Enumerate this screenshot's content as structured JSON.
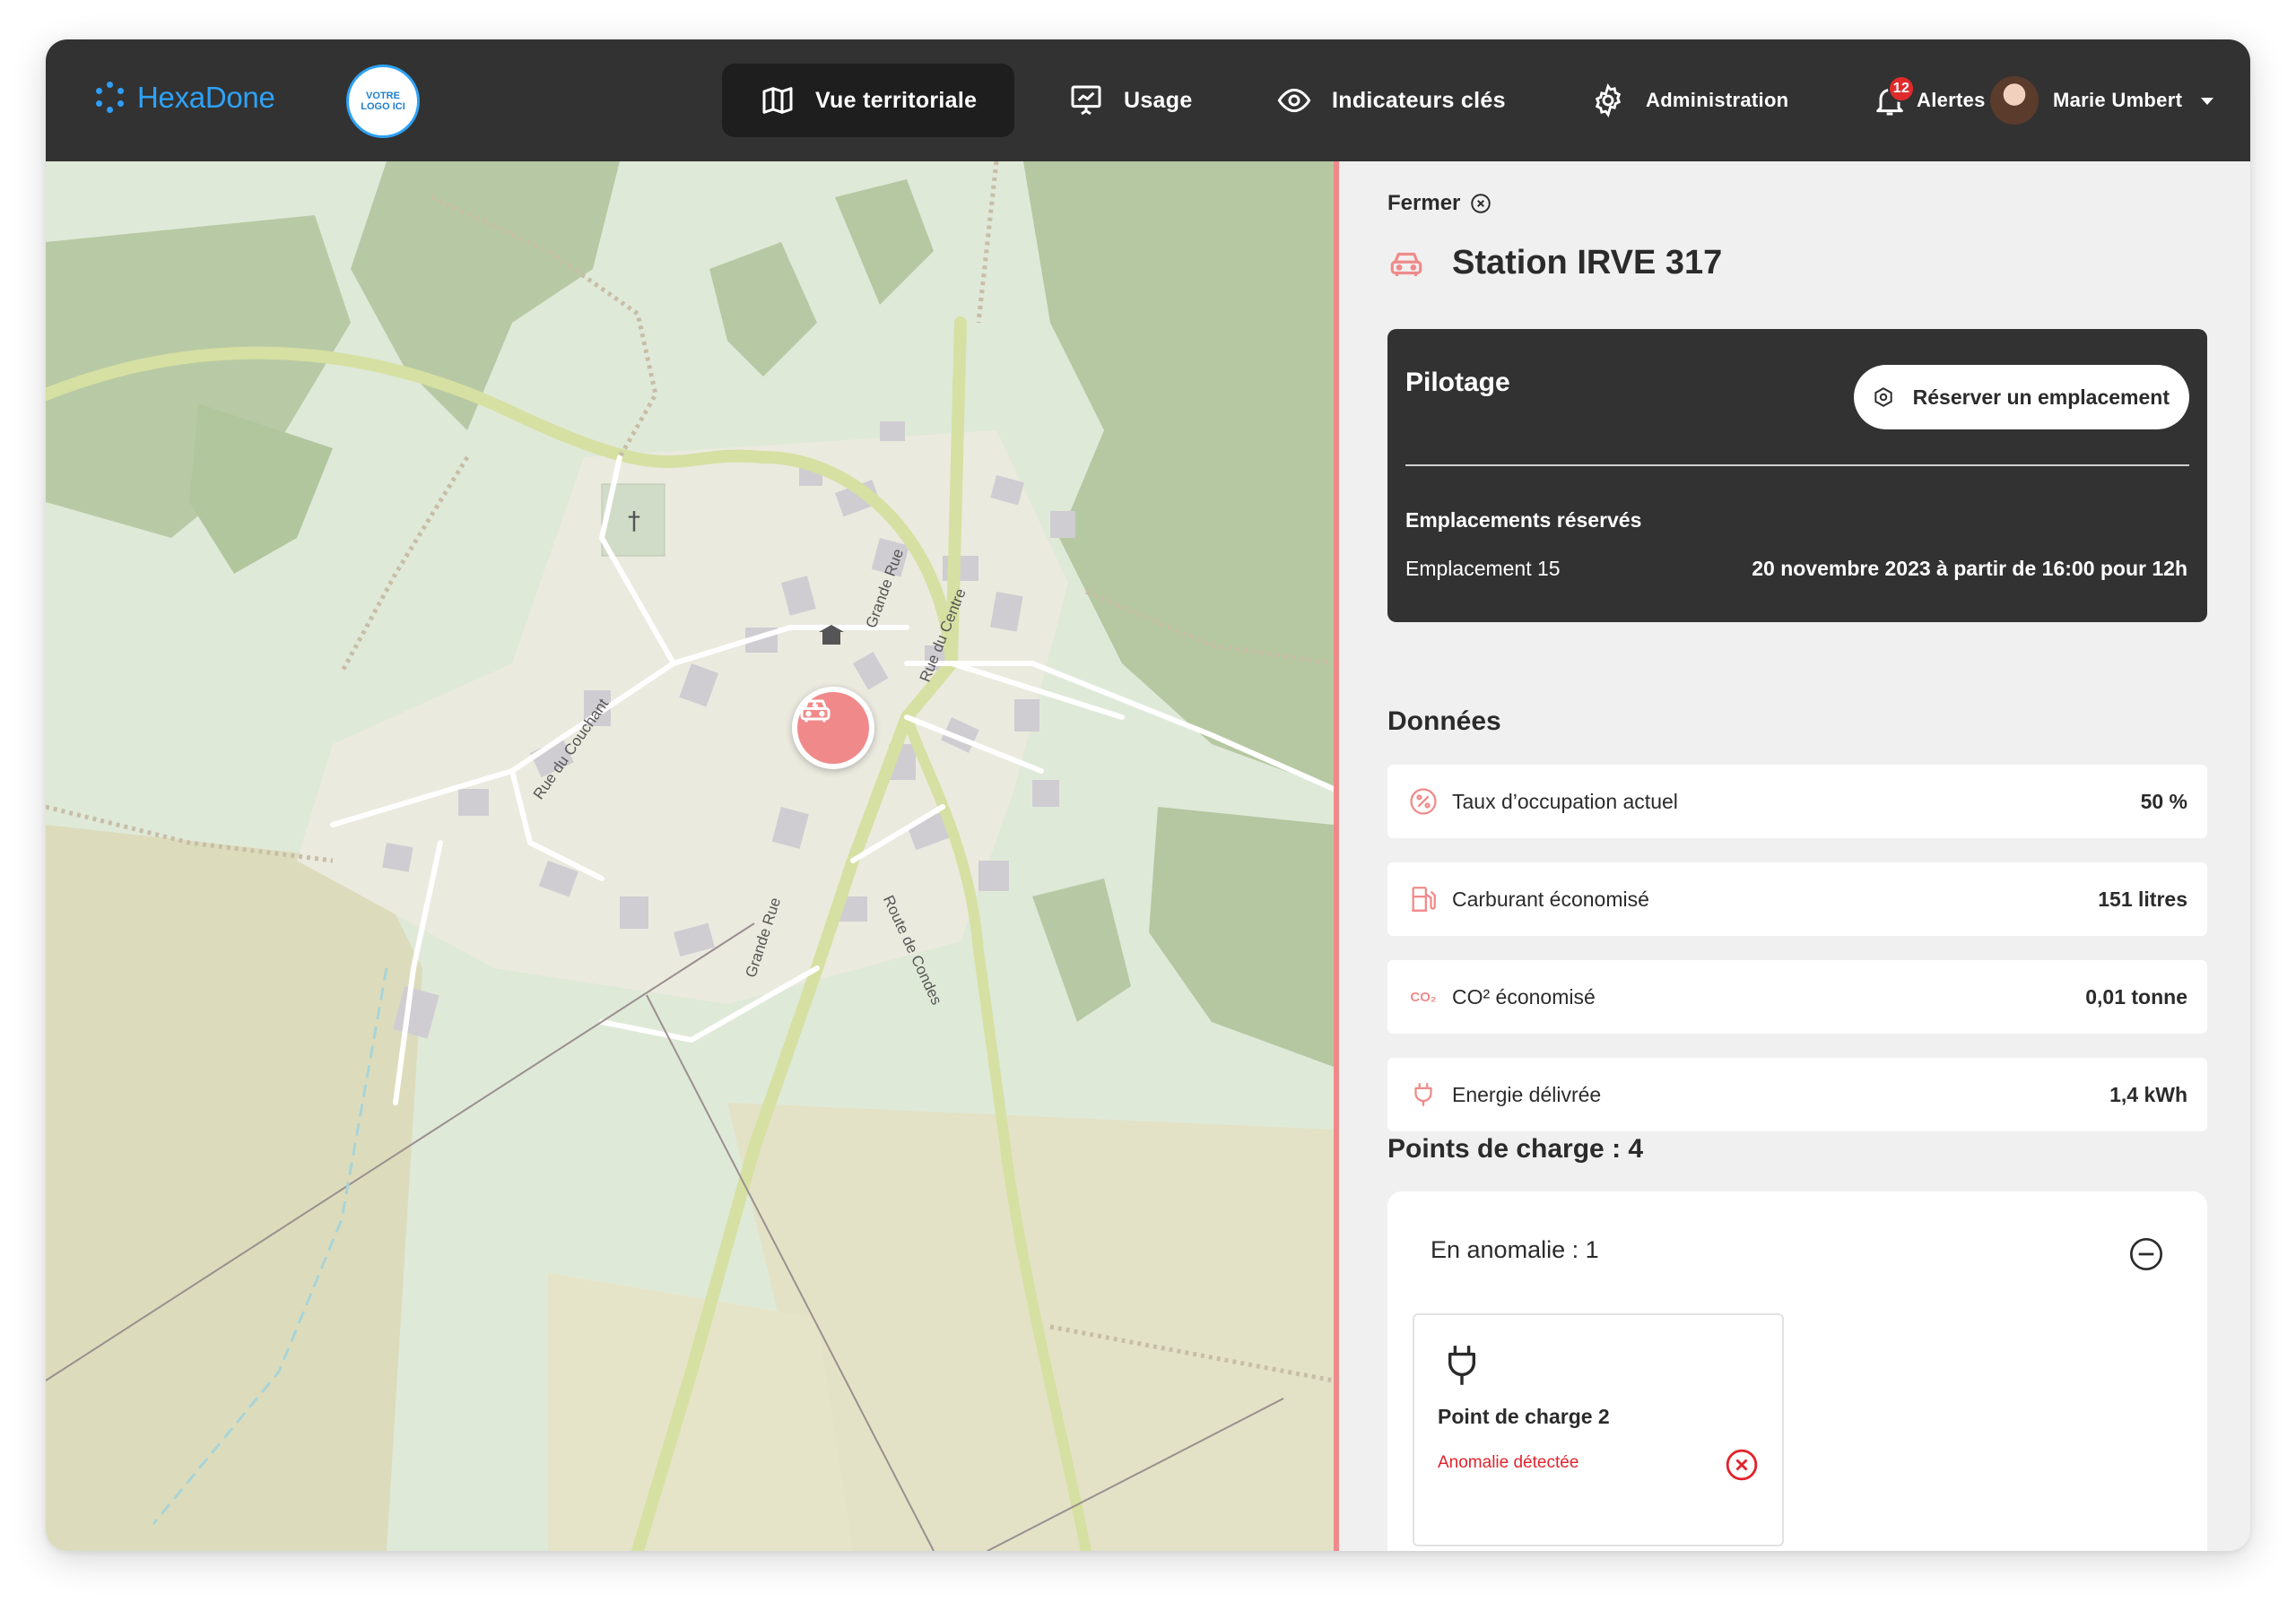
{
  "brand": {
    "name": "HexaDone",
    "client_logo": "VOTRE\nLOGO ICI"
  },
  "nav": {
    "items": [
      {
        "label": "Vue territoriale",
        "icon": "map-icon",
        "active": true
      },
      {
        "label": "Usage",
        "icon": "presentation-chart-icon"
      },
      {
        "label": "Indicateurs clés",
        "icon": "eye-icon"
      },
      {
        "label": "Administration",
        "icon": "gear-icon"
      },
      {
        "label": "Alertes",
        "icon": "bell-icon",
        "badge": "12"
      }
    ],
    "user": {
      "name": "Marie Umbert",
      "icon": "chevron-down-icon"
    }
  },
  "map": {
    "street_labels": [
      "Grande Rue",
      "Rue du Centre",
      "Rue du Couchant",
      "Grande Rue",
      "Route de Condes"
    ],
    "marker_icon": "charging-station-icon"
  },
  "panel": {
    "close_label": "Fermer",
    "station_title": "Station IRVE 317",
    "station_icon": "charging-station-icon",
    "pilotage": {
      "title": "Pilotage",
      "reserve_button": "Réserver un emplacement",
      "reserved_title": "Emplacements réservés",
      "reservation": {
        "slot": "Emplacement 15",
        "date": "20 novembre 2023 à partir de 16:00 pour 12h"
      }
    },
    "data_title": "Données",
    "data": [
      {
        "label": "Taux d’occupation actuel",
        "value": "50 %",
        "icon": "percent-icon"
      },
      {
        "label": "Carburant économisé",
        "value": "151 litres",
        "icon": "fuel-pump-icon"
      },
      {
        "label": "CO² économisé",
        "value": "0,01 tonne",
        "icon": "co2-icon",
        "icon_text": "CO₂"
      },
      {
        "label": "Energie délivrée",
        "value": "1,4 kWh",
        "icon": "plug-icon"
      }
    ],
    "charge_points_title": "Points de charge : 4",
    "anomaly": {
      "heading": "En anomalie : 1",
      "card": {
        "name": "Point de charge 2",
        "status": "Anomalie détectée"
      }
    }
  },
  "colors": {
    "accent": "#f08a8a",
    "dark": "#323232",
    "brand": "#2ea2f6",
    "error": "#e0242c"
  }
}
